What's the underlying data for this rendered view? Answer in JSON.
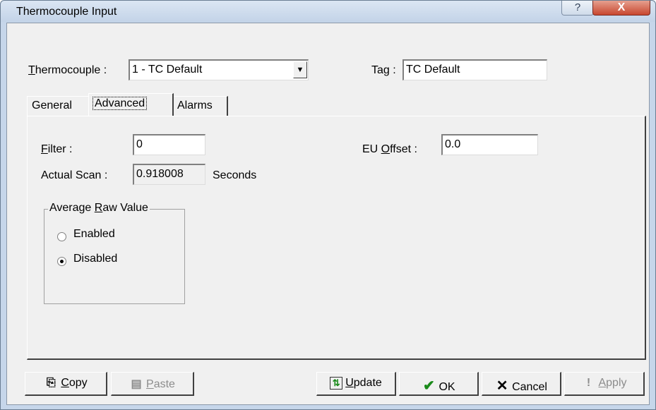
{
  "window": {
    "title": "Thermocouple Input",
    "help_glyph": "?",
    "close_glyph": "X"
  },
  "header": {
    "thermocouple_label": "Thermocouple :",
    "thermocouple_label_mnemonic": "T",
    "thermocouple_label_rest": "hermocouple :",
    "thermocouple_value": "1 - TC Default",
    "tag_label": "Tag :",
    "tag_value": "TC Default"
  },
  "tabs": [
    {
      "label": "General",
      "active": false
    },
    {
      "label": "Advanced",
      "active": true
    },
    {
      "label": "Alarms",
      "active": false
    }
  ],
  "advanced": {
    "filter_label_mnemonic": "F",
    "filter_label_rest": "ilter :",
    "filter_value": "0",
    "eu_offset_label_pre": "EU ",
    "eu_offset_label_mnemonic": "O",
    "eu_offset_label_rest": "ffset :",
    "eu_offset_value": "0.0",
    "actual_scan_label": "Actual Scan :",
    "actual_scan_value": "0.918008",
    "actual_scan_unit": "Seconds",
    "average_group": {
      "legend_pre": "Average ",
      "legend_mnemonic": "R",
      "legend_rest": "aw Value",
      "options": [
        {
          "label": "Enabled",
          "selected": false
        },
        {
          "label": "Disabled",
          "selected": true
        }
      ]
    }
  },
  "buttons": {
    "copy": {
      "mnemonic": "C",
      "rest": "opy",
      "icon": "copy-icon"
    },
    "paste": {
      "mnemonic": "P",
      "rest": "aste",
      "icon": "paste-icon",
      "disabled": true
    },
    "update": {
      "mnemonic": "U",
      "rest": "pdate",
      "icon": "update-icon"
    },
    "ok": {
      "label": "OK",
      "icon": "check-icon"
    },
    "cancel": {
      "label": "Cancel",
      "icon": "x-icon"
    },
    "apply": {
      "mnemonic": "A",
      "rest": "pply",
      "icon": "exclamation-icon",
      "disabled": true
    }
  },
  "colors": {
    "close_button": "#c8472f",
    "ok_check": "#1a8a1a",
    "cancel_x": "#1a1a1a",
    "disabled_text": "#8c8c8c"
  }
}
